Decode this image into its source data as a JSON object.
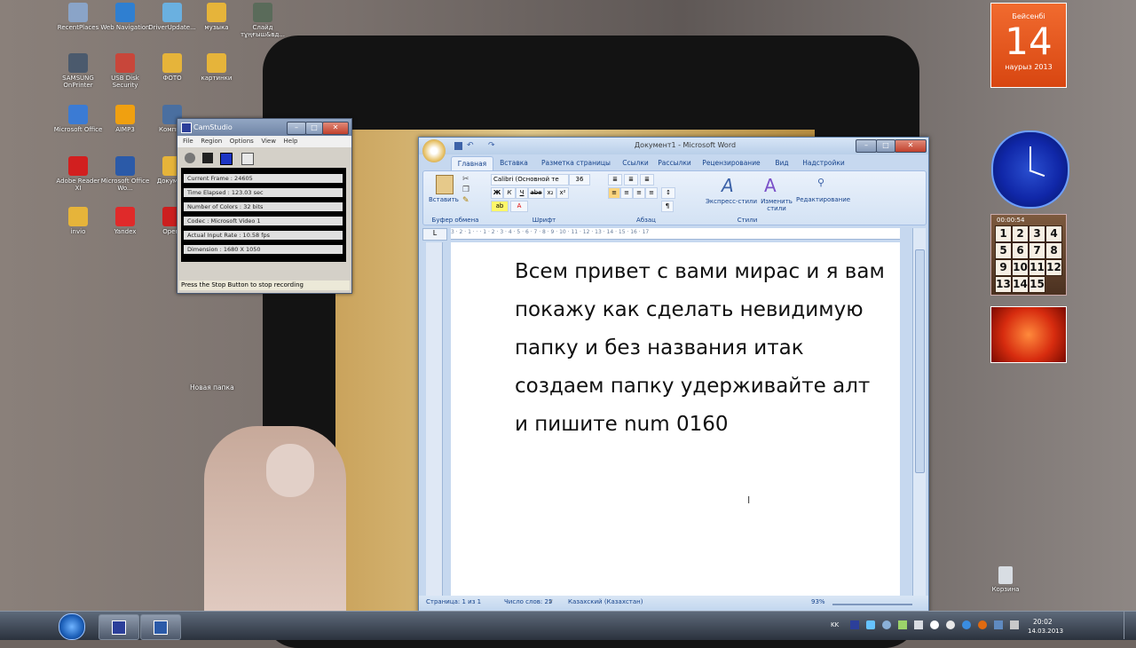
{
  "desktop": {
    "icons": [
      {
        "label": "RecentPlaces",
        "color": "#8aa4c8"
      },
      {
        "label": "Web Navigation",
        "color": "#2f7fd1"
      },
      {
        "label": "DriverUpdate...",
        "color": "#6ab0e0"
      },
      {
        "label": "музыка",
        "color": "#e6b43a"
      },
      {
        "label": "Слайд тұңғыш&вд...",
        "color": "#5a6b5a"
      },
      {
        "label": "SAMSUNG OnPrinter",
        "color": "#4b5a6d"
      },
      {
        "label": "USB Disk Security",
        "color": "#c8463a"
      },
      {
        "label": "ФОТО",
        "color": "#e6b43a"
      },
      {
        "label": "картинки",
        "color": "#e6b43a"
      },
      {
        "label": "Microsoft Office",
        "color": "#3b7bd4"
      },
      {
        "label": "AIMP3",
        "color": "#f0a010"
      },
      {
        "label": "Компь...",
        "color": "#4a6fa0"
      },
      {
        "label": "Adobe Reader XI",
        "color": "#d21f1f"
      },
      {
        "label": "Microsoft Office Wo...",
        "color": "#2b5aa8"
      },
      {
        "label": "Докуме...",
        "color": "#e6b43a"
      },
      {
        "label": "invio",
        "color": "#e6b43a"
      },
      {
        "label": "Yandex",
        "color": "#e02a2a"
      },
      {
        "label": "Opera",
        "color": "#cc1f1f"
      }
    ],
    "new_folder_label": "Новая папка",
    "recycle_bin_label": "Корзина"
  },
  "camstudio": {
    "title": "CamStudio",
    "menu": [
      "File",
      "Region",
      "Options",
      "View",
      "Help"
    ],
    "stats": [
      "Current Frame : 24605",
      "Time Elapsed : 123.03 sec",
      "Number of Colors : 32 bits",
      "Codec : Microsoft Video 1",
      "Actual Input Rate : 10.58 fps",
      "Dimension : 1680 X 1050"
    ],
    "status": "Press the Stop Button to stop recording"
  },
  "word": {
    "title": "Документ1 - Microsoft Word",
    "tabs": [
      "Главная",
      "Вставка",
      "Разметка страницы",
      "Ссылки",
      "Рассылки",
      "Рецензирование",
      "Вид",
      "Надстройки"
    ],
    "font_name": "Calibri (Основной те",
    "font_size": "36",
    "paste_label": "Вставить",
    "styles_label": "Экспресс-стили",
    "change_styles_label": "Изменить стили",
    "editing_label": "Редактирование",
    "groups": [
      "Буфер обмена",
      "Шрифт",
      "Абзац",
      "Стили"
    ],
    "document_text": "Всем привет с вами мирас и я вам  покажу как сделать невидимую папку и без названия итак создаем папку удерживайте алт и  пишите num 0160",
    "status": {
      "page": "Страница: 1 из 1",
      "words": "Число слов: 25",
      "language": "Казахский (Казахстан)",
      "zoom": "93%"
    },
    "ruler_numbers": "3 · 2 · 1 · · · 1 · 2 · 3 · 4 · 5 · 6 · 7 · 8 · 9 · 10 · 11 · 12 · 13 · 14 · 15 · 16 · 17"
  },
  "calendar": {
    "weekday": "Бейсенбі",
    "day": "14",
    "month_year": "наурыз 2013"
  },
  "puzzle": {
    "timer": "00:00:54",
    "tiles": [
      "1",
      "2",
      "3",
      "4",
      "5",
      "6",
      "7",
      "8",
      "9",
      "10",
      "11",
      "12",
      "13",
      "14",
      "15",
      ""
    ]
  },
  "taskbar": {
    "lang": "KK",
    "time": "20:02",
    "date": "14.03.2013"
  }
}
